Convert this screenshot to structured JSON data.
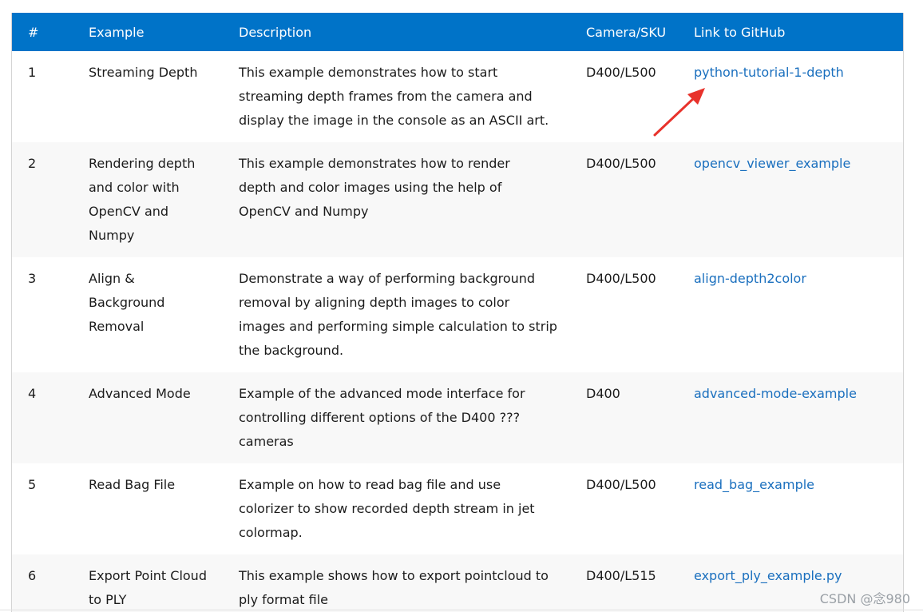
{
  "table": {
    "headers": [
      "#",
      "Example",
      "Description",
      "Camera/SKU",
      "Link to GitHub"
    ],
    "rows": [
      {
        "num": "1",
        "example": "Streaming Depth",
        "description": "This example demonstrates how to start streaming depth frames from the camera and display the image in the console as an ASCII art.",
        "sku": "D400/L500",
        "link": "python-tutorial-1-depth"
      },
      {
        "num": "2",
        "example": "Rendering depth and color with OpenCV and Numpy",
        "description": "This example demonstrates how to render depth and color images using the help of OpenCV and Numpy",
        "sku": "D400/L500",
        "link": "opencv_viewer_example"
      },
      {
        "num": "3",
        "example": "Align & Background Removal",
        "description": "Demonstrate a way of performing background removal by aligning depth images to color images and performing simple calculation to strip the background.",
        "sku": "D400/L500",
        "link": "align-depth2color"
      },
      {
        "num": "4",
        "example": "Advanced Mode",
        "description": "Example of the advanced mode interface for controlling different options of the D400 ??? cameras",
        "sku": "D400",
        "link": "advanced-mode-example"
      },
      {
        "num": "5",
        "example": "Read Bag File",
        "description": "Example on how to read bag file and use colorizer to show recorded depth stream in jet colormap.",
        "sku": "D400/L500",
        "link": "read_bag_example"
      },
      {
        "num": "6",
        "example": "Export Point Cloud to PLY",
        "description": "This example shows how to export pointcloud to ply format file",
        "sku": "D400/L515",
        "link": "export_ply_example.py"
      }
    ]
  },
  "watermark": "CSDN @念980",
  "colors": {
    "header_bg": "#0073c8",
    "link": "#1a6fbe",
    "arrow": "#e8322b",
    "stripe": "#f8f8f8"
  },
  "annotation": {
    "icon": "red-arrow-icon"
  }
}
